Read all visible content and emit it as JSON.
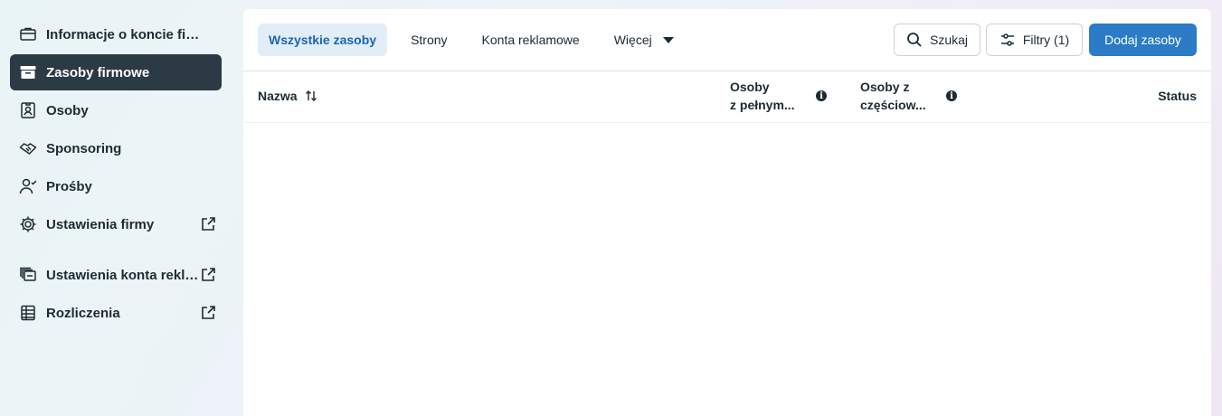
{
  "sidebar": {
    "items": [
      {
        "label": "Informacje o koncie firm...",
        "icon": "briefcase-icon"
      },
      {
        "label": "Zasoby firmowe",
        "icon": "archive-box-icon"
      },
      {
        "label": "Osoby",
        "icon": "id-badge-icon"
      },
      {
        "label": "Sponsoring",
        "icon": "handshake-icon"
      },
      {
        "label": "Prośby",
        "icon": "user-check-icon"
      },
      {
        "label": "Ustawienia firmy",
        "icon": "gear-icon"
      },
      {
        "label": "Ustawienia konta rekla...",
        "icon": "ad-cards-icon"
      },
      {
        "label": "Rozliczenia",
        "icon": "billing-stack-icon"
      }
    ]
  },
  "tabs": [
    {
      "label": "Wszystkie zasoby"
    },
    {
      "label": "Strony"
    },
    {
      "label": "Konta reklamowe"
    },
    {
      "label": "Więcej"
    }
  ],
  "toolbar": {
    "search_label": "Szukaj",
    "filters_label": "Filtry (1)",
    "add_label": "Dodaj zasoby"
  },
  "table": {
    "col_name": "Nazwa",
    "col_full_1": "Osoby",
    "col_full_2": "z pełnym...",
    "col_partial_1": "Osoby z",
    "col_partial_2": "częściow...",
    "col_status": "Status"
  },
  "colors": {
    "active_nav_bg": "#2c3a45",
    "active_tab_bg": "#e2edf8",
    "active_tab_text": "#1b66b3",
    "primary_button": "#2b7bc6"
  }
}
